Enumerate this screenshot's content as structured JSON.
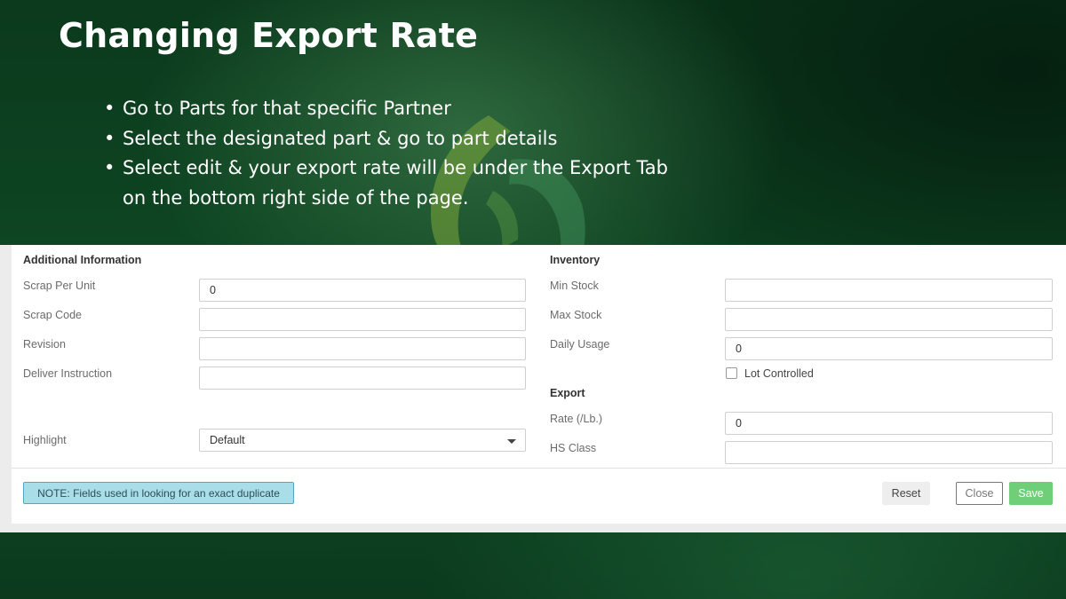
{
  "slide": {
    "title": "Changing Export Rate",
    "bullets": [
      "Go to Parts for that specific Partner",
      "Select the designated part & go to part details",
      "Select edit & your export rate will be under the Export Tab on the bottom right side of the page."
    ],
    "bullet_glyph": "•"
  },
  "form": {
    "additional": {
      "heading": "Additional Information",
      "scrap_per_unit": {
        "label": "Scrap Per Unit",
        "value": "0"
      },
      "scrap_code": {
        "label": "Scrap Code",
        "value": ""
      },
      "revision": {
        "label": "Revision",
        "value": ""
      },
      "deliver_instruction": {
        "label": "Deliver Instruction",
        "value": ""
      },
      "highlight": {
        "label": "Highlight",
        "value": "Default"
      }
    },
    "inventory": {
      "heading": "Inventory",
      "min_stock": {
        "label": "Min Stock",
        "value": ""
      },
      "max_stock": {
        "label": "Max Stock",
        "value": ""
      },
      "daily_usage": {
        "label": "Daily Usage",
        "value": "0"
      },
      "lot_controlled": {
        "label": "Lot Controlled",
        "checked": false
      }
    },
    "export": {
      "heading": "Export",
      "rate": {
        "label": "Rate (/Lb.)",
        "value": "0"
      },
      "hs_class": {
        "label": "HS Class",
        "value": ""
      }
    }
  },
  "footer": {
    "note": "NOTE: Fields used in looking for an exact duplicate",
    "reset_label": "Reset",
    "close_label": "Close",
    "save_label": "Save"
  },
  "colors": {
    "background": "#0d3a1f",
    "note_bg": "#a9dde8",
    "save_bg": "#6fcf78"
  }
}
